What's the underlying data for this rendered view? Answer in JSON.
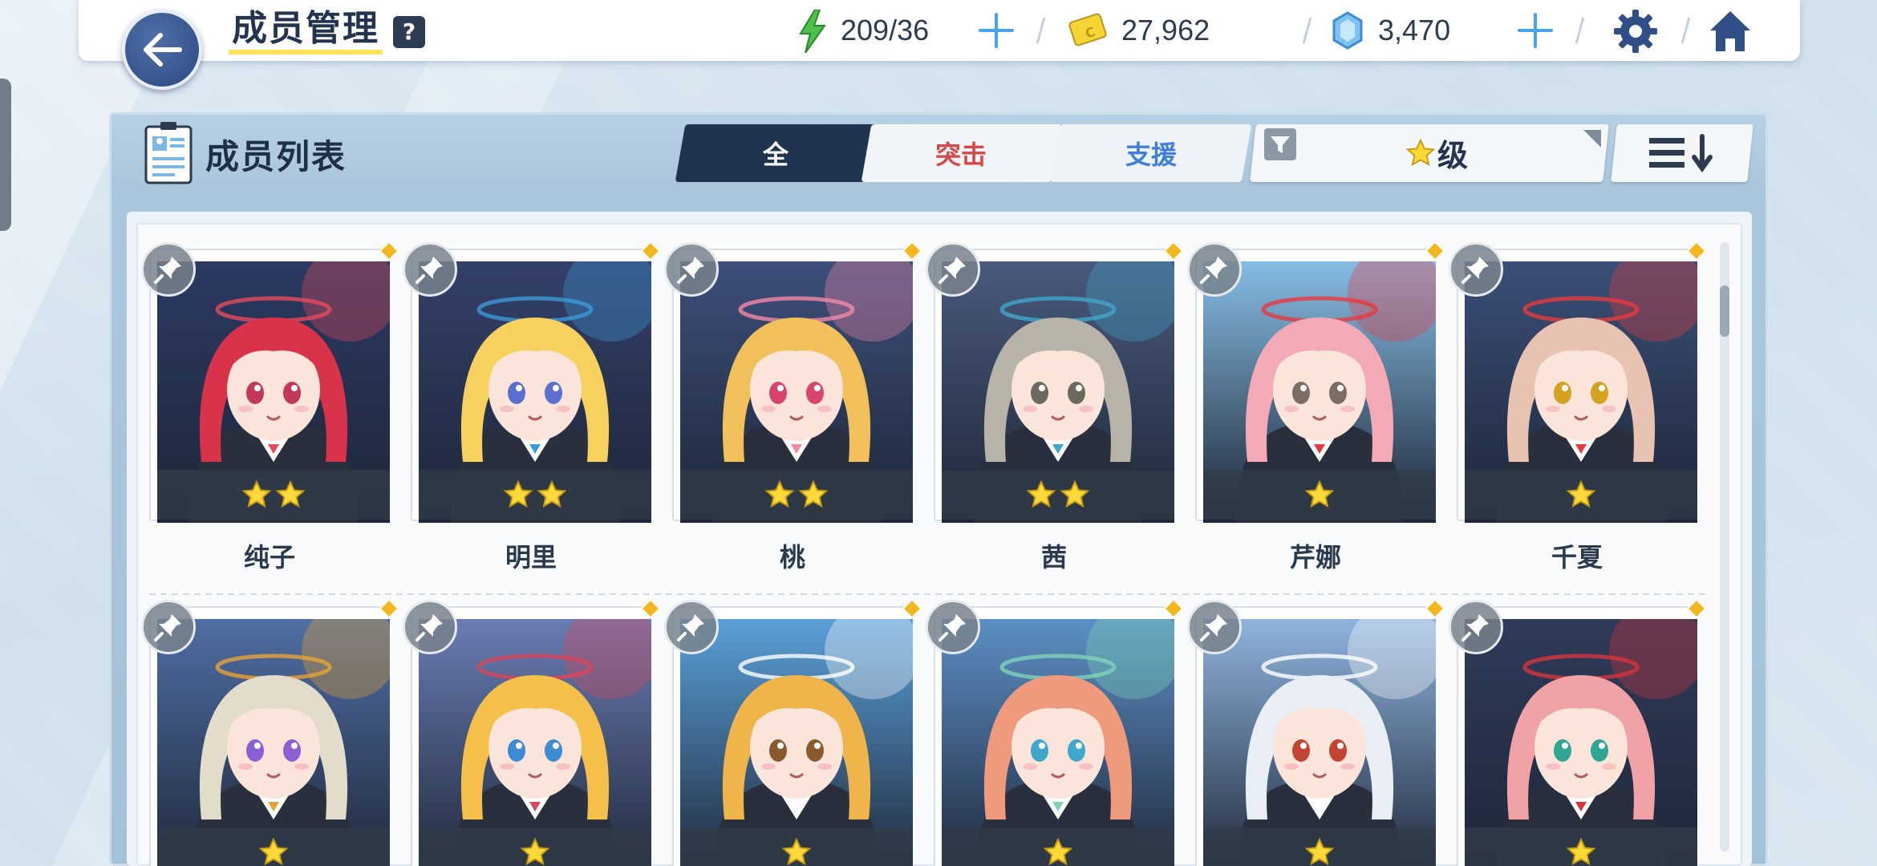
{
  "header": {
    "title": "成员管理",
    "help_label": "?",
    "stamina": "209/36",
    "credits": "27,962",
    "gems": "3,470"
  },
  "panel": {
    "title": "成员列表",
    "tabs": [
      {
        "label": "全",
        "color": "#ffffff"
      },
      {
        "label": "突击",
        "color": "#d44848"
      },
      {
        "label": "支援",
        "color": "#3f7fd9"
      }
    ],
    "filter_label": "级"
  },
  "characters": [
    {
      "name": "纯子",
      "stars": 2,
      "hair": "#d8334a",
      "bg": "#2b3a63",
      "accent": "#e94a5d",
      "eye": "#c2385a"
    },
    {
      "name": "明里",
      "stars": 2,
      "hair": "#f7d15e",
      "bg": "#33406a",
      "accent": "#3b9ad8",
      "eye": "#5a6fd0"
    },
    {
      "name": "桃",
      "stars": 2,
      "hair": "#f1c05a",
      "bg": "#3d4f7a",
      "accent": "#f28aa8",
      "eye": "#d9446f"
    },
    {
      "name": "茜",
      "stars": 2,
      "hair": "#b8b3a8",
      "bg": "#4a5a7d",
      "accent": "#3fa7c9",
      "eye": "#6c6a5e"
    },
    {
      "name": "芹娜",
      "stars": 1,
      "hair": "#f3a9b6",
      "bg": "#86bde3",
      "accent": "#e8383e",
      "eye": "#7d6b66"
    },
    {
      "name": "千夏",
      "stars": 1,
      "hair": "#e8c3b2",
      "bg": "#3b4f78",
      "accent": "#e63b3b",
      "eye": "#d4a21e"
    },
    {
      "name": "",
      "stars": 1,
      "hair": "#e3dccb",
      "bg": "#4f6ea3",
      "accent": "#e8a233",
      "eye": "#8d5fd4"
    },
    {
      "name": "",
      "stars": 1,
      "hair": "#f4c04a",
      "bg": "#6a7db3",
      "accent": "#d9465a",
      "eye": "#3f8bd3"
    },
    {
      "name": "",
      "stars": 1,
      "hair": "#f0b54a",
      "bg": "#5aa0d8",
      "accent": "#ffffff",
      "eye": "#8b5a2c"
    },
    {
      "name": "",
      "stars": 1,
      "hair": "#ef9a7c",
      "bg": "#5c8fc4",
      "accent": "#7fd3b8",
      "eye": "#3fa7c9"
    },
    {
      "name": "",
      "stars": 1,
      "hair": "#e9eef4",
      "bg": "#8fb4dd",
      "accent": "#ffffff",
      "eye": "#c44433"
    },
    {
      "name": "",
      "stars": 1,
      "hair": "#f1a2a6",
      "bg": "#2f3b59",
      "accent": "#d8343b",
      "eye": "#2fa593"
    }
  ]
}
